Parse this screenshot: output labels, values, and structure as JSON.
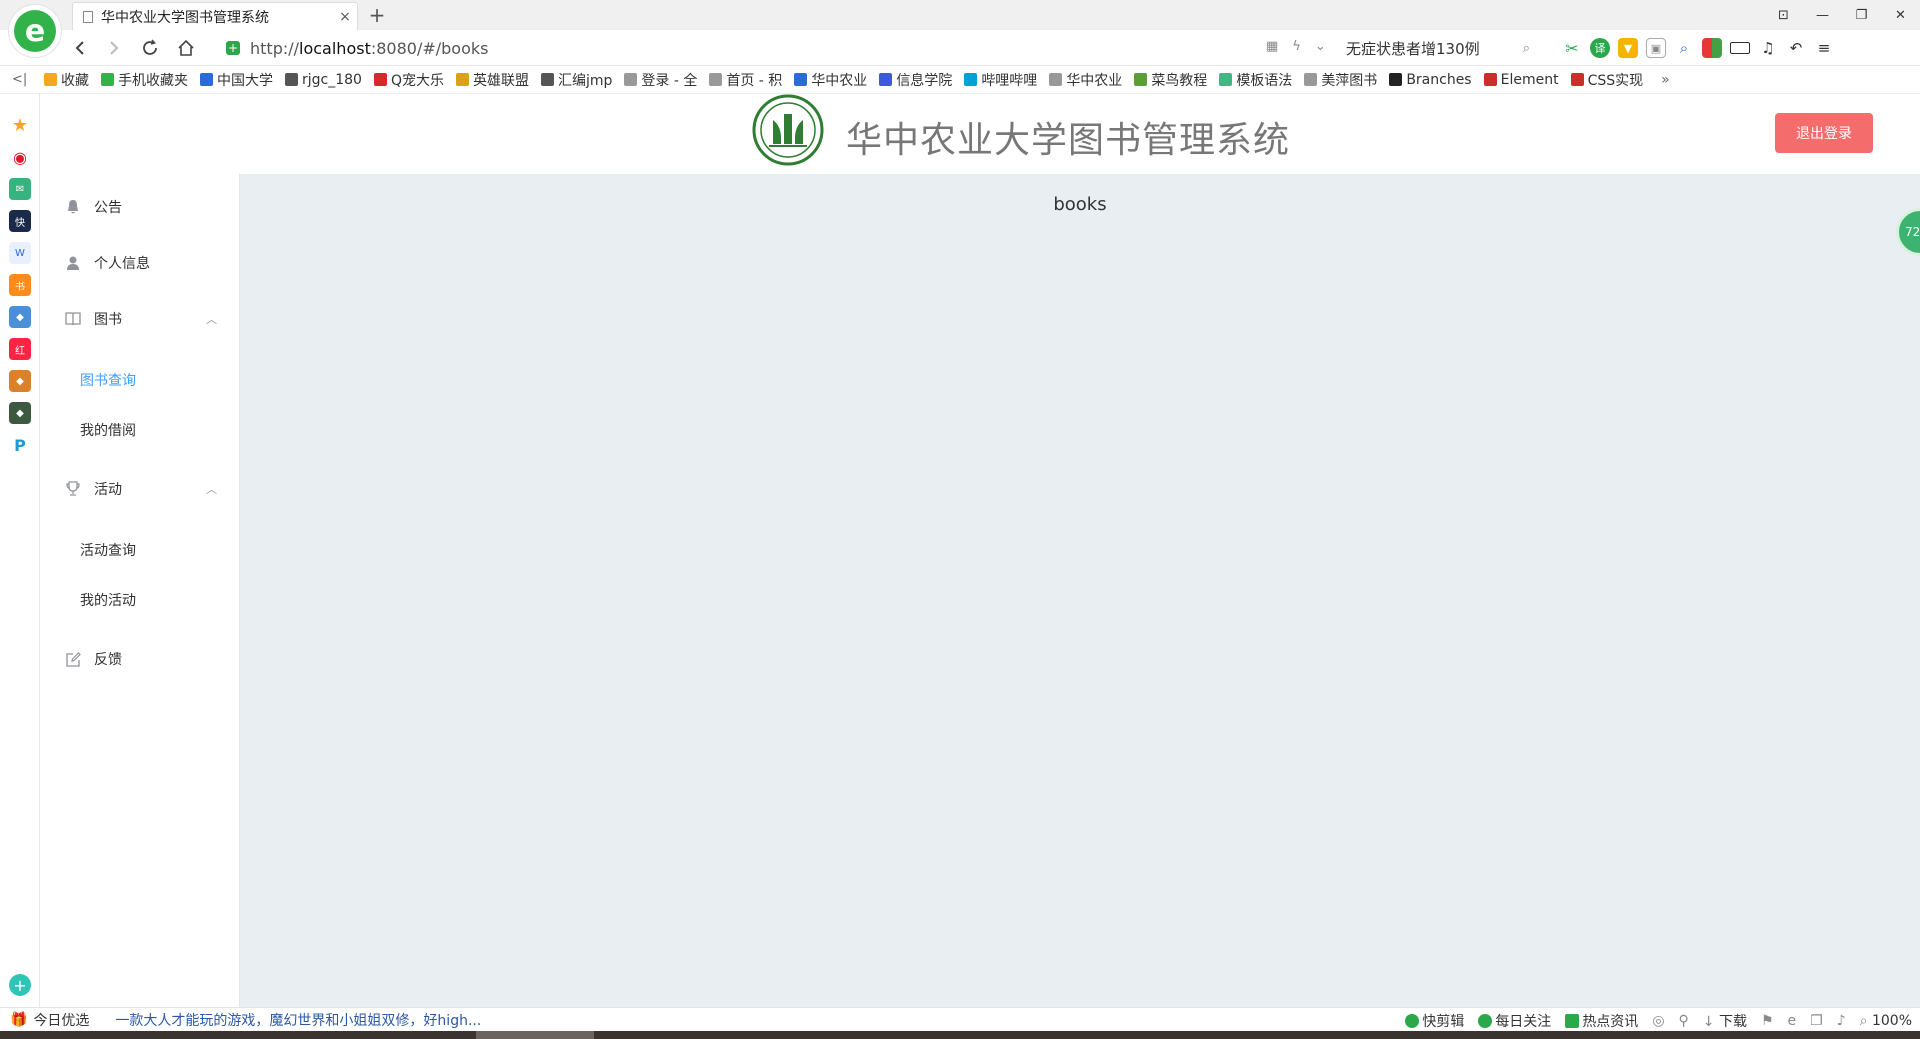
{
  "browser": {
    "tab_title": "华中农业大学图书管理系统",
    "tab_close": "×",
    "new_tab": "+",
    "url_scheme": "http://",
    "url_host": "localhost",
    "url_rest": ":8080/#/books",
    "search_text": "无症状患者增130例",
    "window_controls": [
      "⊡",
      "—",
      "❐",
      "✕"
    ],
    "bookmarks_toggle": "<|",
    "bookmarks": [
      {
        "label": "收藏",
        "icon": "star-icon",
        "color": "#f5a623"
      },
      {
        "label": "手机收藏夹",
        "icon": "phone-icon",
        "color": "#31b34a"
      },
      {
        "label": "中国大学",
        "icon": "book-icon",
        "color": "#2a6bd6"
      },
      {
        "label": "rjgc_180",
        "icon": "code-icon",
        "color": "#555555"
      },
      {
        "label": "Q宠大乐",
        "icon": "game-icon",
        "color": "#d62a2a"
      },
      {
        "label": "英雄联盟",
        "icon": "game-icon",
        "color": "#d9a21b"
      },
      {
        "label": "汇编jmp",
        "icon": "code-icon",
        "color": "#555555"
      },
      {
        "label": "登录 - 全",
        "icon": "page-icon",
        "color": "#999999"
      },
      {
        "label": "首页 - 积",
        "icon": "page-icon",
        "color": "#999999"
      },
      {
        "label": "华中农业",
        "icon": "school-icon",
        "color": "#2a6bd6"
      },
      {
        "label": "信息学院",
        "icon": "link-icon",
        "color": "#3b5bdb"
      },
      {
        "label": "哔哩哔哩",
        "icon": "tv-icon",
        "color": "#00a1d6"
      },
      {
        "label": "华中农业",
        "icon": "page-icon",
        "color": "#999999"
      },
      {
        "label": "菜鸟教程",
        "icon": "runoob-icon",
        "color": "#5a9e35"
      },
      {
        "label": "模板语法",
        "icon": "vue-icon",
        "color": "#41b883"
      },
      {
        "label": "美萍图书",
        "icon": "page-icon",
        "color": "#999999"
      },
      {
        "label": "Branches",
        "icon": "github-icon",
        "color": "#222222"
      },
      {
        "label": "Element",
        "icon": "csdn-icon",
        "color": "#c9302c"
      },
      {
        "label": "CSS实现",
        "icon": "csdn-icon",
        "color": "#c9302c"
      }
    ],
    "bookmarks_more": "»"
  },
  "app": {
    "title": "华中农业大学图书管理系统",
    "logout_label": "退出登录",
    "menu": {
      "announcement": "公告",
      "profile": "个人信息",
      "books": "图书",
      "book_search": "图书查询",
      "my_borrow": "我的借阅",
      "activity": "活动",
      "activity_search": "活动查询",
      "my_activity": "我的活动",
      "feedback": "反馈"
    },
    "content_text": "books",
    "float_badge": "72"
  },
  "statusbar": {
    "today": "今日优选",
    "news": "一款大人才能玩的游戏，魔幻世界和小姐姐双修，好high...",
    "quick_edit": "快剪辑",
    "daily": "每日关注",
    "hot": "热点资讯",
    "download": "下载",
    "zoom": "100%"
  },
  "colors": {
    "accent": "#409eff",
    "danger": "#f56c6c",
    "content_bg": "#e9eef3",
    "brand_green": "#2e7d32"
  }
}
